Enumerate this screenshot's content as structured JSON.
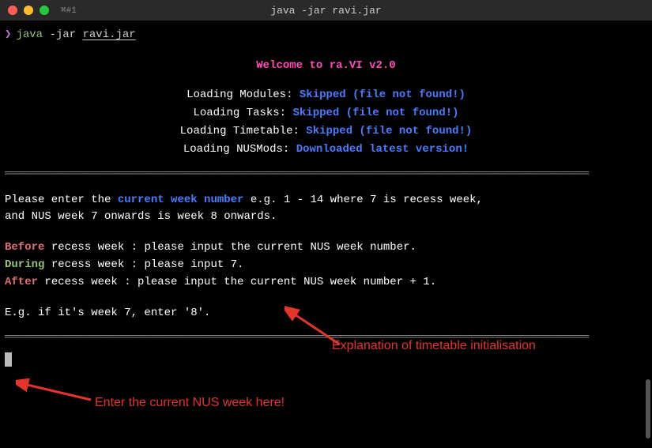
{
  "titlebar": {
    "icon_text": "⌘#1",
    "title": "java -jar ravi.jar"
  },
  "prompt": {
    "arrow": "❯",
    "cmd": "java",
    "flag": "-jar",
    "arg": "ravi.jar"
  },
  "welcome": "Welcome to ra.VI v2.0",
  "loading": {
    "modules_label": "Loading Modules: ",
    "modules_status": "Skipped (file not found!)",
    "tasks_label": "Loading Tasks: ",
    "tasks_status": "Skipped (file not found!)",
    "timetable_label": "Loading Timetable: ",
    "timetable_status": "Skipped (file not found!)",
    "nusmods_label": "Loading NUSMods: ",
    "nusmods_status": "Downloaded latest version!"
  },
  "divider": "════════════════════════════════════════════════════════════════════════════════════════",
  "intro": {
    "part1": "Please enter the ",
    "highlight": "current week number",
    "part2": " e.g. 1 - 14 where 7 is recess week,",
    "line2": "and NUS week 7 onwards is week 8 onwards."
  },
  "rules": {
    "before_kw": "Before",
    "before_rest": " recess week : please input the current NUS week number.",
    "during_kw": "During",
    "during_rest": " recess week : please input 7.",
    "after_kw": "After",
    "after_rest": " recess week  : please input the current NUS week number + 1."
  },
  "example": "E.g. if it's week 7, enter '8'.",
  "annotations": {
    "explanation": "Explanation of timetable initialisation",
    "enter_here": "Enter the current NUS week here!"
  }
}
